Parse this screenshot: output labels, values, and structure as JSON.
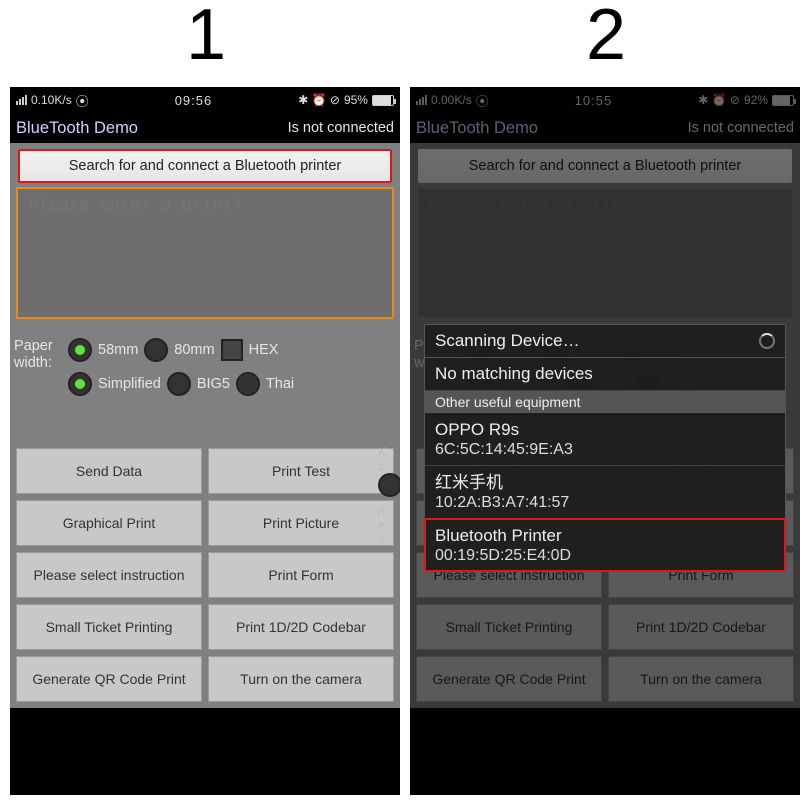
{
  "step_labels": {
    "one": "1",
    "two": "2"
  },
  "statusbar": {
    "p1": {
      "speed": "0.10K/s",
      "time": "09:56",
      "battery": "95%",
      "icons": "✱ ⏰ ⊘"
    },
    "p2": {
      "speed": "0.00K/s",
      "time": "10:55",
      "battery": "92%",
      "icons": "✱ ⏰ ⊘"
    }
  },
  "titlebar": {
    "title": "BlueTooth Demo",
    "status": "Is not connected"
  },
  "search_button": "Search for and connect a Bluetooth printer",
  "textarea_placeholder": "Please enter a print!",
  "paper": {
    "label": "Paper width:",
    "opt_58": "58mm",
    "opt_80": "80mm",
    "opt_hex": "HEX",
    "opt_simplified": "Simplified",
    "opt_big5": "BIG5",
    "opt_thai": "Thai"
  },
  "buttons": {
    "send_data": "Send Data",
    "print_test": "Print Test",
    "graphical_print": "Graphical Print",
    "print_picture": "Print Picture",
    "select_instruction": "Please select instruction",
    "print_form": "Print Form",
    "small_ticket": "Small Ticket Printing",
    "codebar": "Print 1D/2D Codebar",
    "qr": "Generate QR Code Print",
    "camera": "Turn on the camera"
  },
  "dialog": {
    "header": "Scanning Device…",
    "no_match": "No matching devices",
    "section": "Other useful equipment",
    "items": [
      {
        "name": "OPPO R9s",
        "mac": "6C:5C:14:45:9E:A3"
      },
      {
        "name": "红米手机",
        "mac": "10:2A:B3:A7:41:57"
      },
      {
        "name": "Bluetooth Printer",
        "mac": "00:19:5D:25:E4:0D"
      }
    ]
  }
}
